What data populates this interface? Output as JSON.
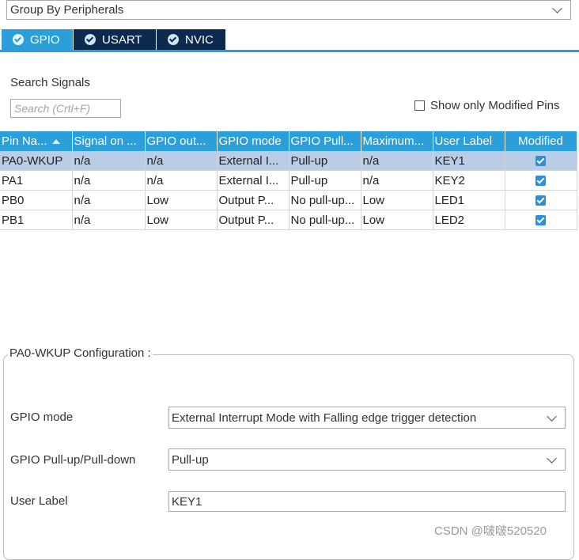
{
  "group_by": {
    "value": "Group By Peripherals"
  },
  "tabs": [
    {
      "label": "GPIO",
      "active": true
    },
    {
      "label": "USART",
      "active": false
    },
    {
      "label": "NVIC",
      "active": false
    }
  ],
  "search": {
    "label": "Search Signals",
    "placeholder": "Search (Crtl+F)",
    "show_modified_label": "Show only Modified Pins",
    "show_modified_checked": false
  },
  "table": {
    "headers": [
      "Pin Na...",
      "Signal on ...",
      "GPIO out...",
      "GPIO mode",
      "GPIO Pull...",
      "Maximum...",
      "User Label",
      "Modified"
    ],
    "rows": [
      {
        "pin": "PA0-WKUP",
        "signal": "n/a",
        "output": "n/a",
        "mode": "External I...",
        "pull": "Pull-up",
        "maximum": "n/a",
        "label": "KEY1",
        "modified": true,
        "selected": true
      },
      {
        "pin": "PA1",
        "signal": "n/a",
        "output": "n/a",
        "mode": "External I...",
        "pull": "Pull-up",
        "maximum": "n/a",
        "label": "KEY2",
        "modified": true,
        "selected": false
      },
      {
        "pin": "PB0",
        "signal": "n/a",
        "output": "Low",
        "mode": "Output P...",
        "pull": "No pull-up...",
        "maximum": "Low",
        "label": "LED1",
        "modified": true,
        "selected": false
      },
      {
        "pin": "PB1",
        "signal": "n/a",
        "output": "Low",
        "mode": "Output P...",
        "pull": "No pull-up...",
        "maximum": "Low",
        "label": "LED2",
        "modified": true,
        "selected": false
      }
    ]
  },
  "config": {
    "title": "PA0-WKUP Configuration :",
    "gpio_mode_label": "GPIO mode",
    "gpio_mode_value": "External Interrupt Mode with Falling edge trigger detection",
    "pull_label": "GPIO Pull-up/Pull-down",
    "pull_value": "Pull-up",
    "user_label_label": "User Label",
    "user_label_value": "KEY1"
  },
  "watermark": "CSDN @啵啵520520",
  "colors": {
    "accent": "#2b9fd9",
    "tab_inactive": "#0c2a4e",
    "selected_row": "#b9cde6",
    "check": "#2b8fe0"
  }
}
